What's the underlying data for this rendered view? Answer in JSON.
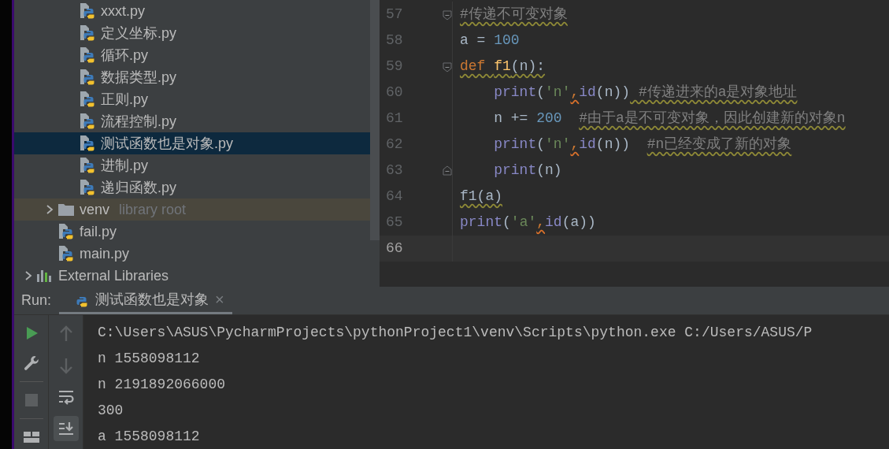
{
  "project_tree": {
    "items": [
      {
        "children": [
          {
            "children": [
              {
                "label": "xxxt.py",
                "kind": "python",
                "selected": false
              },
              {
                "label": "定义坐标.py",
                "kind": "python",
                "selected": false
              },
              {
                "label": "循环.py",
                "kind": "python",
                "selected": false
              },
              {
                "label": "数据类型.py",
                "kind": "python",
                "selected": false
              },
              {
                "label": "正则.py",
                "kind": "python",
                "selected": false
              },
              {
                "label": "流程控制.py",
                "kind": "python",
                "selected": false
              },
              {
                "label": "测试函数也是对象.py",
                "kind": "python",
                "selected": true
              },
              {
                "label": "进制.py",
                "kind": "python",
                "selected": false
              },
              {
                "label": "递归函数.py",
                "kind": "python",
                "selected": false
              }
            ]
          },
          {
            "label": "venv",
            "suffix": "library root",
            "kind": "folder",
            "expanded": false,
            "selected": false
          },
          {
            "label": "fail.py",
            "kind": "python",
            "selected": false
          },
          {
            "label": "main.py",
            "kind": "python",
            "selected": false
          }
        ]
      },
      {
        "label": "External Libraries",
        "kind": "libraries",
        "expanded": false,
        "selected": false
      }
    ]
  },
  "editor": {
    "lines": [
      {
        "number": "57",
        "fold_start": true,
        "current": false,
        "tokens": [
          {
            "text": "#传递不可变对象",
            "kind": "comment",
            "squiggle": true
          }
        ]
      },
      {
        "number": "58",
        "current": false,
        "tokens": [
          {
            "text": "a = ",
            "kind": "plain",
            "squiggle": false
          },
          {
            "text": "100",
            "kind": "number",
            "squiggle": false
          }
        ]
      },
      {
        "number": "59",
        "fold_start": true,
        "current": false,
        "tokens": [
          {
            "text": "def ",
            "kind": "keyword",
            "squiggle": true
          },
          {
            "text": "f1",
            "kind": "fn",
            "squiggle": true
          },
          {
            "text": "(n):",
            "kind": "plain",
            "squiggle": true
          }
        ]
      },
      {
        "number": "60",
        "current": false,
        "tokens": [
          {
            "text": "    print",
            "kind": "builtin",
            "squiggle": false
          },
          {
            "text": "(",
            "kind": "plain",
            "squiggle": false
          },
          {
            "text": "'n'",
            "kind": "string",
            "squiggle": false
          },
          {
            "text": ",",
            "kind": "punct",
            "squiggle": true
          },
          {
            "text": "id",
            "kind": "builtin",
            "squiggle": false
          },
          {
            "text": "(n))",
            "kind": "plain",
            "squiggle": false
          },
          {
            "text": " #传递进来的a是对象地址",
            "kind": "comment",
            "squiggle": true
          }
        ]
      },
      {
        "number": "61",
        "current": false,
        "tokens": [
          {
            "text": "    n += ",
            "kind": "plain",
            "squiggle": false
          },
          {
            "text": "200  ",
            "kind": "number",
            "squiggle": false
          },
          {
            "text": "#由于a是不可变对象，因此创建新的对象n",
            "kind": "comment",
            "squiggle": true
          }
        ]
      },
      {
        "number": "62",
        "current": false,
        "tokens": [
          {
            "text": "    print",
            "kind": "builtin",
            "squiggle": false
          },
          {
            "text": "(",
            "kind": "plain",
            "squiggle": false
          },
          {
            "text": "'n'",
            "kind": "string",
            "squiggle": false
          },
          {
            "text": ",",
            "kind": "punct",
            "squiggle": true
          },
          {
            "text": "id",
            "kind": "builtin",
            "squiggle": false
          },
          {
            "text": "(n))  ",
            "kind": "plain",
            "squiggle": false
          },
          {
            "text": "#n已经变成了新的对象",
            "kind": "comment",
            "squiggle": true
          }
        ]
      },
      {
        "number": "63",
        "fold_end": true,
        "current": false,
        "tokens": [
          {
            "text": "    print",
            "kind": "builtin",
            "squiggle": false
          },
          {
            "text": "(n)",
            "kind": "plain",
            "squiggle": false
          }
        ]
      },
      {
        "number": "64",
        "current": false,
        "tokens": [
          {
            "text": "f1(a)",
            "kind": "plain",
            "squiggle": true
          }
        ]
      },
      {
        "number": "65",
        "current": false,
        "tokens": [
          {
            "text": "print",
            "kind": "builtin",
            "squiggle": false
          },
          {
            "text": "(",
            "kind": "plain",
            "squiggle": false
          },
          {
            "text": "'a'",
            "kind": "string",
            "squiggle": false
          },
          {
            "text": ",",
            "kind": "punct",
            "squiggle": true
          },
          {
            "text": "id",
            "kind": "builtin",
            "squiggle": false
          },
          {
            "text": "(a))",
            "kind": "plain",
            "squiggle": false
          }
        ]
      },
      {
        "number": "66",
        "current": true
      }
    ]
  },
  "run_panel": {
    "label": "Run:",
    "tabs": [
      {
        "label": "测试函数也是对象",
        "close": "×",
        "selected": true
      }
    ],
    "output": [
      "C:\\Users\\ASUS\\PycharmProjects\\pythonProject1\\venv\\Scripts\\python.exe C:/Users/ASUS/P",
      "n 1558098112",
      "n 2191892066000",
      "300",
      "a 1558098112"
    ]
  }
}
